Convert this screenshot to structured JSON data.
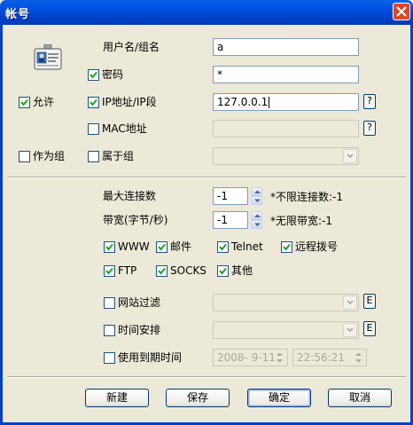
{
  "window": {
    "title": "帐号",
    "close_icon": "close-icon"
  },
  "form": {
    "username_label": "用户名/组名",
    "username_value": "a",
    "password_label": "密码",
    "password_value": "*",
    "allow_label": "允许",
    "ip_label": "IP地址/IP段",
    "ip_value": "127.0.0.1",
    "mac_label": "MAC地址",
    "mac_value": "",
    "as_group_label": "作为组",
    "belongs_group_label": "属于组",
    "help_label": "?"
  },
  "limits": {
    "max_conn_label": "最大连接数",
    "max_conn_value": "-1",
    "max_conn_hint": "*不限连接数:-1",
    "bandwidth_label": "带宽(字节/秒)",
    "bandwidth_value": "-1",
    "bandwidth_hint": "*无限带宽:-1"
  },
  "protocols": [
    {
      "label": "WWW",
      "checked": true
    },
    {
      "label": "邮件",
      "checked": true
    },
    {
      "label": "Telnet",
      "checked": true
    },
    {
      "label": "远程拨号",
      "checked": true
    },
    {
      "label": "FTP",
      "checked": true
    },
    {
      "label": "SOCKS",
      "checked": true
    },
    {
      "label": "其他",
      "checked": true
    }
  ],
  "filters": {
    "site_filter_label": "网站过滤",
    "schedule_label": "时间安排",
    "expire_label": "使用到期时间",
    "expire_date": "2008- 9-11",
    "expire_time": "22:56:21",
    "edit_label": "E"
  },
  "buttons": {
    "new": "新建",
    "save": "保存",
    "ok": "确定",
    "cancel": "取消"
  },
  "colors": {
    "titlebar": "#0054E3",
    "dialog_bg": "#ECE9D8",
    "checkmark": "#21A121",
    "close_button": "#D9472B"
  }
}
